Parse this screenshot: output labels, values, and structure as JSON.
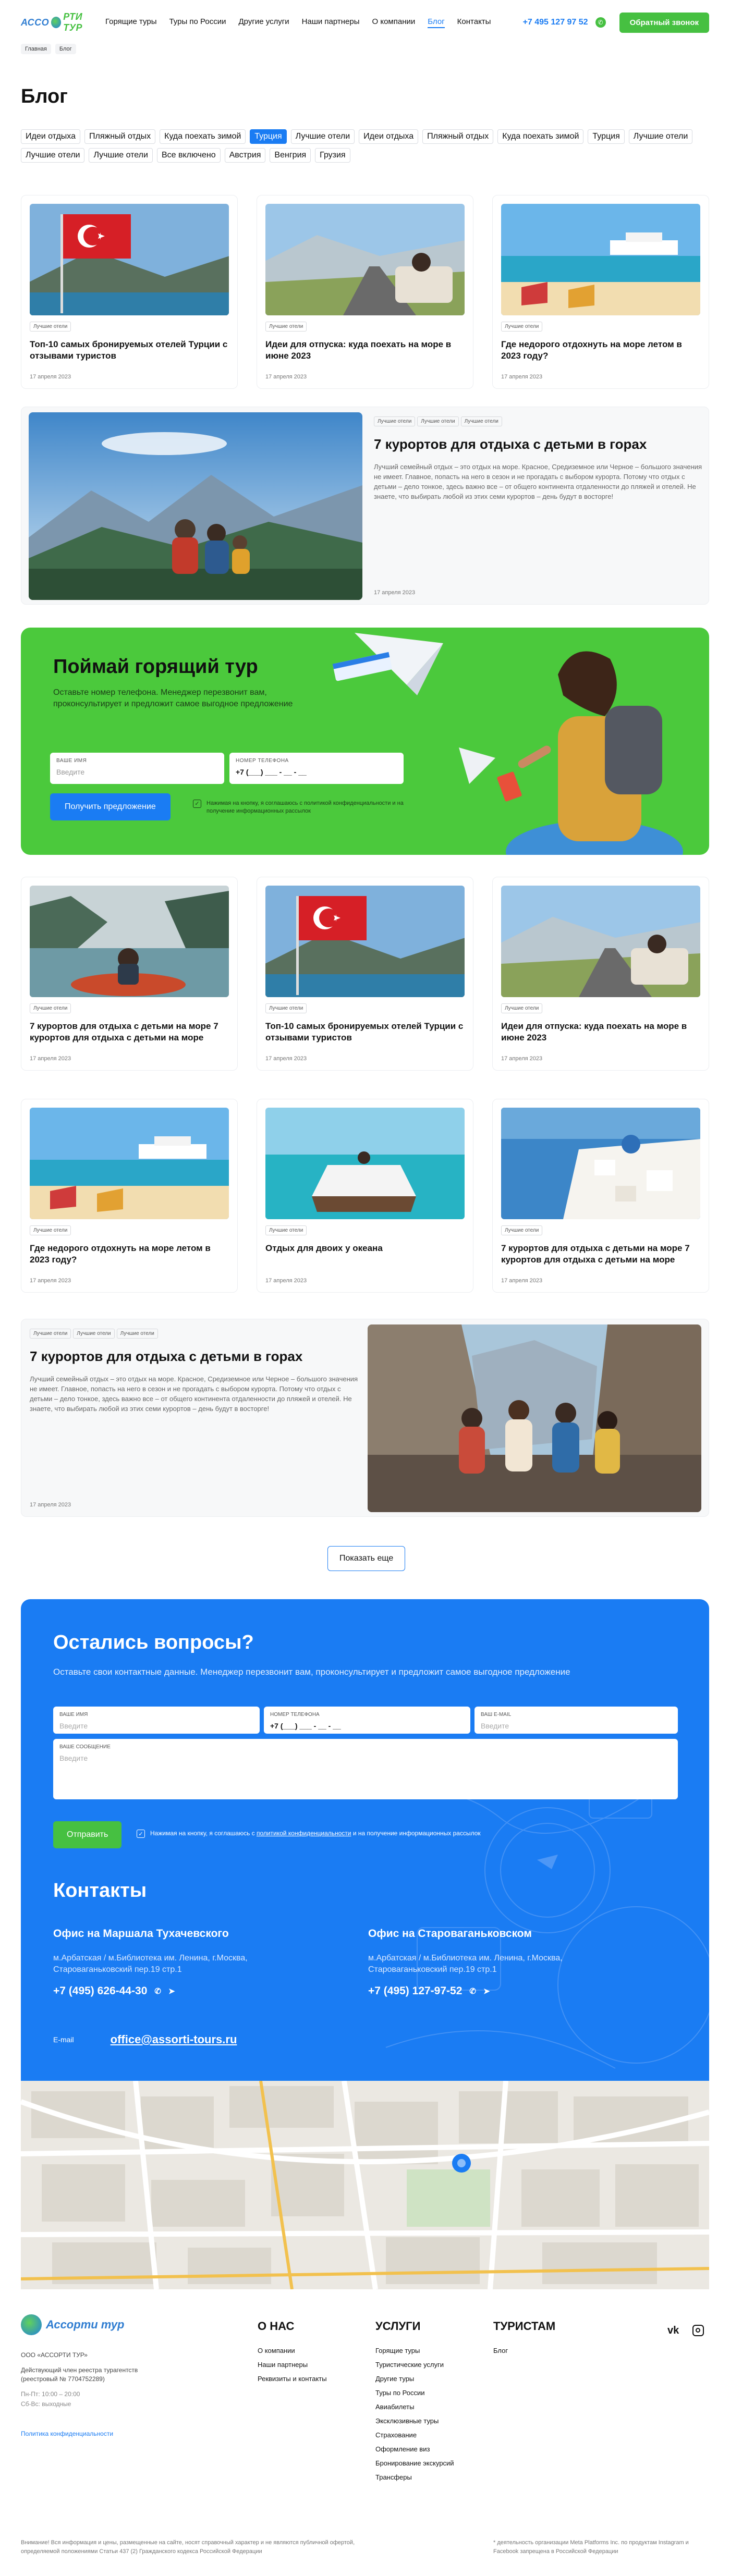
{
  "header": {
    "logo_a": "АССО",
    "logo_b": "РТИ ТУР",
    "nav": [
      "Горящие туры",
      "Туры по России",
      "Другие услуги",
      "Наши партнеры",
      "О компании",
      "Блог",
      "Контакты"
    ],
    "active_nav": 5,
    "phone": "+7 495 127 97 52",
    "callback": "Обратный звонок"
  },
  "breadcrumbs": [
    "Главная",
    "Блог"
  ],
  "title": "Блог",
  "tags": [
    "Идеи отдыха",
    "Пляжный отдых",
    "Куда поехать зимой",
    "Турция",
    "Лучшие отели",
    "Идеи отдыха",
    "Пляжный отдых",
    "Куда поехать зимой",
    "Турция",
    "Лучшие отели",
    "Лучшие отели",
    "Лучшие отели",
    "Все включено",
    "Австрия",
    "Венгрия",
    "Грузия"
  ],
  "active_tag": 3,
  "cards_row1": [
    {
      "tag": "Лучшие отели",
      "title": "Топ-10 самых бронируемых отелей Турции с отзывами туристов",
      "date": "17 апреля 2023",
      "img": "turkey"
    },
    {
      "tag": "Лучшие отели",
      "title": "Идеи для отпуска: куда поехать на море в июне 2023",
      "date": "17 апреля 2023",
      "img": "road"
    },
    {
      "tag": "Лучшие отели",
      "title": "Где недорого отдохнуть на море летом в 2023 году?",
      "date": "17 апреля 2023",
      "img": "beach"
    }
  ],
  "wide1": {
    "tags": [
      "Лучшие отели",
      "Лучшие отели",
      "Лучшие отели"
    ],
    "title": "7 курортов для отдыха с детьми в горах",
    "desc": "Лучший семейный отдых – это отдых на море. Красное, Средиземное или Черное – большого значения не имеет. Главное, попасть на него в сезон и не прогадать с выбором курорта. Потому что отдых с детьми – дело тонкое, здесь важно все – от общего континента отдаленности до пляжей и отелей. Не знаете, что выбирать любой из этих семи курортов – день будут в восторге!",
    "date": "17 апреля 2023"
  },
  "promo": {
    "title": "Поймай горящий тур",
    "text": "Оставьте номер телефона. Менеджер перезвонит вам, проконсультирует и предложит самое выгодное предложение",
    "name_label": "ВАШЕ ИМЯ",
    "name_ph": "Введите",
    "phone_label": "НОМЕР ТЕЛЕФОНА",
    "phone_val": "+7 (___) ___ - __ - __",
    "btn": "Получить предложение",
    "consent": "Нажимая на кнопку, я соглашаюсь с политикой конфиденциальности и на получение информационных рассылок"
  },
  "cards_row2": [
    {
      "tag": "Лучшие отели",
      "title": "7 курортов для отдыха с детьми на море 7 курортов для отдыха с детьми на море",
      "date": "17 апреля 2023",
      "img": "kayak"
    },
    {
      "tag": "Лучшие отели",
      "title": "Топ-10 самых бронируемых отелей Турции с отзывами туристов",
      "date": "17 апреля 2023",
      "img": "turkey"
    },
    {
      "tag": "Лучшие отели",
      "title": "Идеи для отпуска: куда поехать на море в июне 2023",
      "date": "17 апреля 2023",
      "img": "road"
    }
  ],
  "cards_row3": [
    {
      "tag": "Лучшие отели",
      "title": "Где недорого отдохнуть на море летом в 2023 году?",
      "date": "17 апреля 2023",
      "img": "beach"
    },
    {
      "tag": "Лучшие отели",
      "title": "Отдых для двоих у океана",
      "date": "17 апреля 2023",
      "img": "ocean"
    },
    {
      "tag": "Лучшие отели",
      "title": "7 курортов для отдыха с детьми на море 7 курортов для отдыха с детьми на море",
      "date": "17 апреля 2023",
      "img": "santorini"
    }
  ],
  "wide2": {
    "tags": [
      "Лучшие отели",
      "Лучшие отели",
      "Лучшие отели"
    ],
    "title": "7 курортов для отдыха с детьми в горах",
    "desc": "Лучший семейный отдых – это отдых на море. Красное, Средиземное или Черное – большого значения не имеет. Главное, попасть на него в сезон и не прогадать с выбором курорта. Потому что отдых с детьми – дело тонкое, здесь важно все – от общего континента отдаленности до пляжей и отелей. Не знаете, что выбирать любой из этих семи курортов – день будут в восторге!",
    "date": "17 апреля 2023"
  },
  "show_more": "Показать еще",
  "questions": {
    "title": "Остались вопросы?",
    "sub": "Оставьте свои контактные данные. Менеджер перезвонит вам, проконсультирует и предложит самое выгодное предложение",
    "name_label": "ВАШЕ ИМЯ",
    "name_ph": "Введите",
    "phone_label": "НОМЕР ТЕЛЕФОНА",
    "phone_val": "+7 (___) ___ - __ - __",
    "email_label": "ВАШ E-MAIL",
    "email_ph": "Введите",
    "msg_label": "ВАШЕ СООБЩЕНИЕ",
    "msg_ph": "Введите",
    "send": "Отправить",
    "consent_a": "Нажимая на кнопку, я соглашаюсь с ",
    "consent_link": "политикой конфиденциальности",
    "consent_b": " и на получение информационных рассылок"
  },
  "contacts": {
    "title": "Контакты",
    "office1": {
      "name": "Офис на Маршала Тухачевского",
      "addr": "м.Арбатская / м.Библиотека им. Ленина, г.Москва, Староваганьковский пер.19 стр.1",
      "phone": "+7 (495) 626-44-30"
    },
    "office2": {
      "name": "Офис на Староваганьковском",
      "addr": "м.Арбатская / м.Библиотека им. Ленина, г.Москва, Староваганьковский пер.19 стр.1",
      "phone": "+7 (495) 127-97-52"
    },
    "email_label": "E-mail",
    "email": "office@assorti-tours.ru"
  },
  "footer": {
    "logo": "Ассорти тур",
    "company": "ООО «АССОРТИ ТУР»",
    "reg": "Действующий член реестра турагентств (реестровый № 7704752289)",
    "hours1": "Пн-Пт: 10:00 – 20:00",
    "hours2": "Сб-Вс: выходные",
    "policy": "Политика конфиденциальности",
    "about_h": "О НАС",
    "about": [
      "О компании",
      "Наши партнеры",
      "Реквизиты и контакты"
    ],
    "serv_h": "УСЛУГИ",
    "serv": [
      "Горящие туры",
      "Туристические услуги",
      "Другие туры",
      "Туры по России",
      "Авиабилеты",
      "Эксклюзивные туры",
      "Страхование",
      "Оформление виз",
      "Бронирование экскурсий",
      "Трансферы"
    ],
    "tour_h": "ТУРИСТАМ",
    "tour": [
      "Блог"
    ],
    "disc1": "Внимание! Вся информация и цены, размещенные на сайте, носят справочный характер и не являются публичной офертой, определяемой положениями Статьи 437 (2) Гражданского кодекса Российской Федерации",
    "disc2": "* деятельность организации Meta Platforms Inc. по продуктам Instagram и Facebook запрещена в Российской Федерации"
  }
}
